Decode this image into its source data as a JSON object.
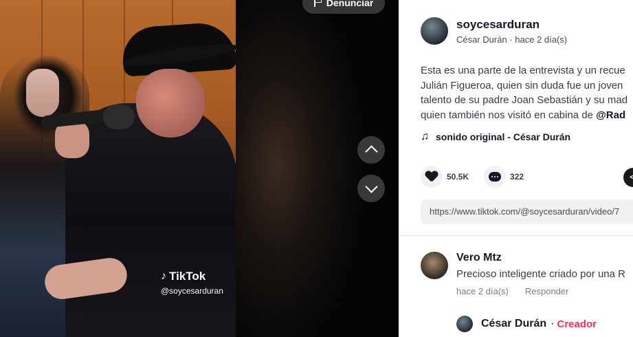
{
  "video": {
    "report_label": "Denunciar",
    "watermark_brand": "TikTok",
    "watermark_handle": "@soycesarduran"
  },
  "post": {
    "username": "soycesarduran",
    "nickname": "César Durán",
    "separator": " · ",
    "time": "hace 2 día(s)",
    "description_lines": [
      "Esta es una parte de la entrevista y un recue",
      "Julián Figueroa, quien sin duda fue un joven",
      "talento de su padre Joan Sebastián y su mad",
      "quien también nos visitó en cabina de "
    ],
    "mention": "@Rad",
    "music": "sonido original - César Durán",
    "likes": "50.5K",
    "comments": "322",
    "share_glyph": "</",
    "link": "https://www.tiktok.com/@soycesarduran/video/7"
  },
  "comment": {
    "author": "Vero Mtz",
    "text": "Precioso inteligente criado por una R",
    "time": "hace 2 día(s)",
    "reply_label": "Responder"
  },
  "reply": {
    "author": "César Durán",
    "separator": "·",
    "badge": "Creador"
  },
  "icons": {
    "report": "flag-icon",
    "prev": "chevron-up-icon",
    "next": "chevron-down-icon",
    "music": "music-note-icon",
    "like": "heart-icon",
    "comment": "comment-bubble-icon",
    "embed": "embed-code-icon"
  },
  "colors": {
    "creator_badge": "#fe2c55",
    "text_primary": "#161823",
    "link_box_bg": "#f1f1f2"
  }
}
